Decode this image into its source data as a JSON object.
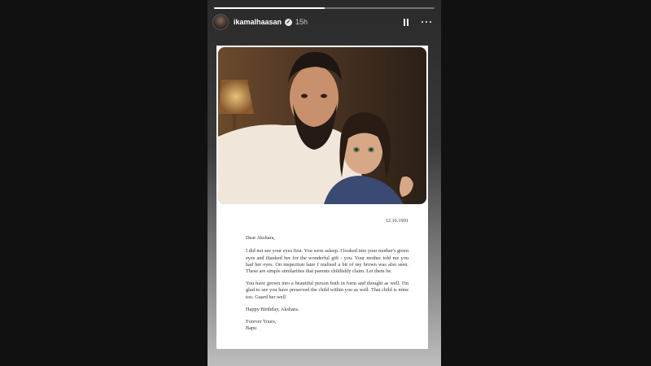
{
  "story": {
    "progress": 0.5,
    "username": "ikamalhaasan",
    "time_ago": "15h",
    "icons": {
      "verified": "verified-badge-icon",
      "pause": "pause-icon",
      "more": "more-options-icon"
    }
  },
  "letter": {
    "date": "12.10.1991",
    "salutation": "Dear Akshara,",
    "paragraph1": "I did not see your eyes first. You were asleep. I looked into your mother's green eyes and thanked her for the wonderful gift - you. Your mother told me you had her eyes. On inspection later I realised a bit of my brown was also seen. These are simple similarities that parents childishly claim. Let them be.",
    "paragraph2": "You have grown into a beautiful person both in form and thought as well. I'm glad to see you have preserved the child within you as well. That child is mine too. Guard her well.",
    "birthday_line": "Happy Birthday, Akshara.",
    "closing": "Forever Yours,",
    "signature": "Bapu"
  }
}
